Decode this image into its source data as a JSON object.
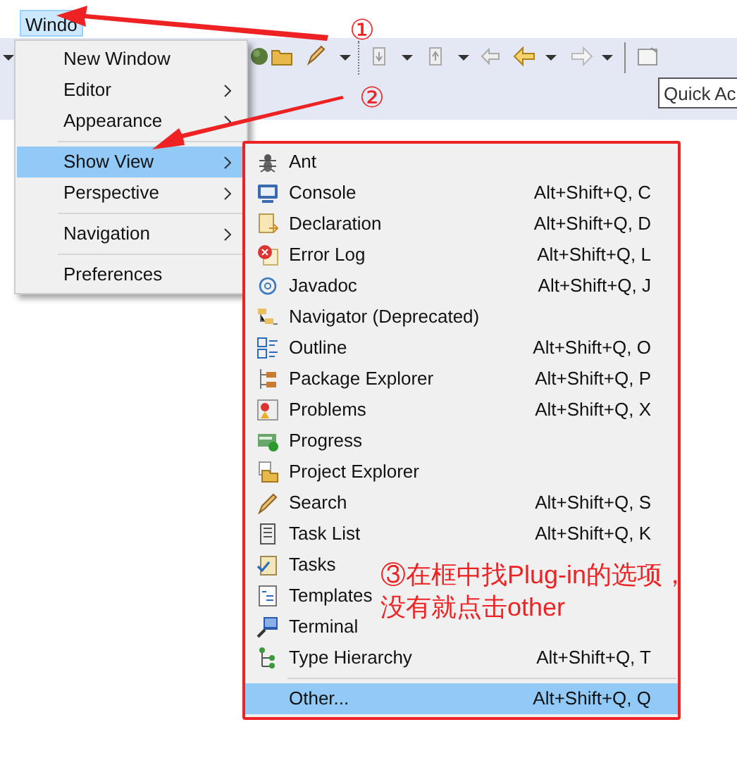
{
  "menu_bar": [
    {
      "label": "Windo",
      "selected": true
    }
  ],
  "quick_access": {
    "placeholder": "Quick Ac"
  },
  "window_menu": [
    {
      "kind": "item",
      "label": "New Window",
      "submenu": false,
      "selected": false
    },
    {
      "kind": "item",
      "label": "Editor",
      "submenu": true,
      "selected": false
    },
    {
      "kind": "item",
      "label": "Appearance",
      "submenu": true,
      "selected": false
    },
    {
      "kind": "separator"
    },
    {
      "kind": "item",
      "label": "Show View",
      "submenu": true,
      "selected": true
    },
    {
      "kind": "item",
      "label": "Perspective",
      "submenu": true,
      "selected": false
    },
    {
      "kind": "separator"
    },
    {
      "kind": "item",
      "label": "Navigation",
      "submenu": true,
      "selected": false
    },
    {
      "kind": "separator"
    },
    {
      "kind": "item",
      "label": "Preferences",
      "submenu": false,
      "selected": false
    }
  ],
  "show_view_menu": [
    {
      "kind": "item",
      "label": "Ant",
      "selected": false
    },
    {
      "kind": "item",
      "label": "Console",
      "shortcut": "Alt+Shift+Q, C",
      "selected": false
    },
    {
      "kind": "item",
      "label": "Declaration",
      "shortcut": "Alt+Shift+Q, D",
      "selected": false
    },
    {
      "kind": "item",
      "label": "Error Log",
      "shortcut": "Alt+Shift+Q, L",
      "selected": false
    },
    {
      "kind": "item",
      "label": "Javadoc",
      "shortcut": "Alt+Shift+Q, J",
      "selected": false
    },
    {
      "kind": "item",
      "label": "Navigator (Deprecated)",
      "selected": false
    },
    {
      "kind": "item",
      "label": "Outline",
      "shortcut": "Alt+Shift+Q, O",
      "selected": false
    },
    {
      "kind": "item",
      "label": "Package Explorer",
      "shortcut": "Alt+Shift+Q, P",
      "selected": false
    },
    {
      "kind": "item",
      "label": "Problems",
      "shortcut": "Alt+Shift+Q, X",
      "selected": false
    },
    {
      "kind": "item",
      "label": "Progress",
      "selected": false
    },
    {
      "kind": "item",
      "label": "Project Explorer",
      "selected": false
    },
    {
      "kind": "item",
      "label": "Search",
      "shortcut": "Alt+Shift+Q, S",
      "selected": false
    },
    {
      "kind": "item",
      "label": "Task List",
      "shortcut": "Alt+Shift+Q, K",
      "selected": false
    },
    {
      "kind": "item",
      "label": "Tasks",
      "selected": false
    },
    {
      "kind": "item",
      "label": "Templates",
      "selected": false
    },
    {
      "kind": "item",
      "label": "Terminal",
      "selected": false
    },
    {
      "kind": "item",
      "label": "Type Hierarchy",
      "shortcut": "Alt+Shift+Q, T",
      "selected": false
    },
    {
      "kind": "separator"
    },
    {
      "kind": "item",
      "label": "Other...",
      "shortcut": "Alt+Shift+Q, Q",
      "selected": true
    }
  ],
  "annotations": [
    {
      "kind": "step",
      "label": "①"
    },
    {
      "kind": "step",
      "label": "②"
    },
    {
      "kind": "note",
      "lines": [
        "③在框中找Plug-in的选项，",
        "没有就点击other"
      ]
    }
  ]
}
